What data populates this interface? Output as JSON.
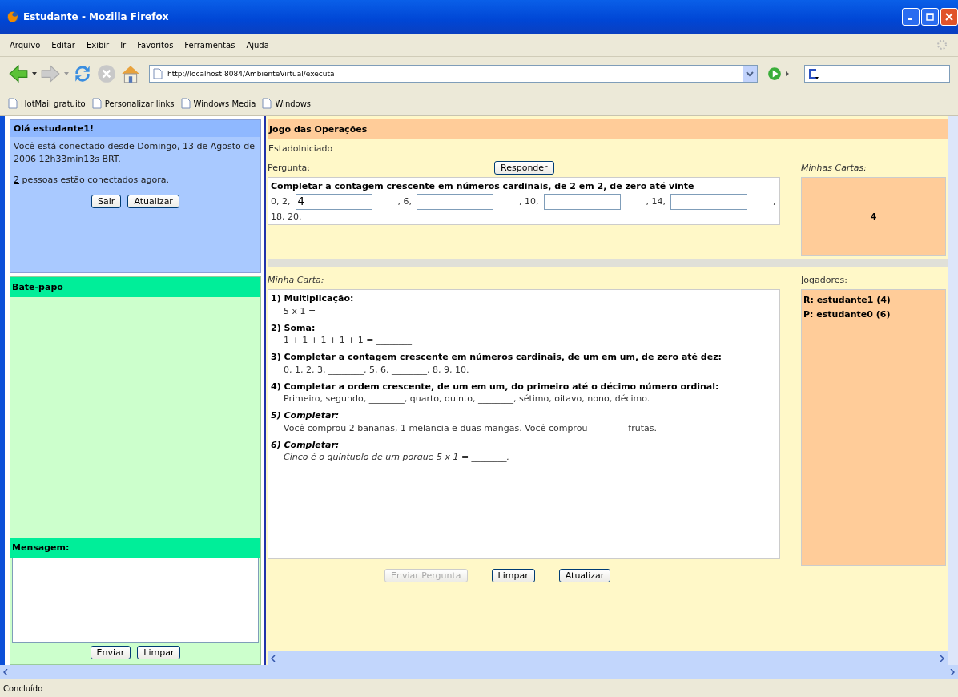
{
  "window": {
    "title": "Estudante - Mozilla Firefox"
  },
  "menu": [
    "Arquivo",
    "Editar",
    "Exibir",
    "Ir",
    "Favoritos",
    "Ferramentas",
    "Ajuda"
  ],
  "address": {
    "value": "http://localhost:8084/AmbienteVirtual/executa"
  },
  "bookmarks": [
    "HotMail gratuito",
    "Personalizar links",
    "Windows Media",
    "Windows"
  ],
  "session": {
    "greeting": "Olá estudante1!",
    "connected_text": "Você está conectado desde Domingo, 13 de Agosto de 2006 12h33min13s BRT.",
    "people_count": "2",
    "people_text": "pessoas estão conectados agora.",
    "buttons": [
      "Sair",
      "Atualizar"
    ]
  },
  "chat": {
    "title": "Bate-papo",
    "message_label": "Mensagem:",
    "buttons": [
      "Enviar",
      "Limpar"
    ]
  },
  "game": {
    "title": "Jogo das Operações",
    "status": "EstadoIniciado",
    "question_label": "Pergunta:",
    "answer_button": "Responder",
    "question": "Completar a contagem crescente em números cardinais, de 2 em 2, de zero até vinte",
    "sequence": [
      {
        "kind": "text",
        "text": "0, 2,"
      },
      {
        "kind": "field",
        "value": "4"
      },
      {
        "kind": "text",
        "text": ", 6,"
      },
      {
        "kind": "field"
      },
      {
        "kind": "text",
        "text": ", 10,"
      },
      {
        "kind": "field"
      },
      {
        "kind": "text",
        "text": ", 14,"
      },
      {
        "kind": "field"
      },
      {
        "kind": "text",
        "text": ","
      },
      {
        "kind": "text",
        "text": "18, 20."
      }
    ],
    "my_cards_label": "Minhas Cartas:",
    "my_cards": [
      "4"
    ],
    "my_card_label": "Minha Carta:",
    "card_items": [
      {
        "heading": "1) Multiplicação:",
        "italic": false,
        "body": "5 x 1 = ________",
        "body_italic": false
      },
      {
        "heading": "2) Soma:",
        "italic": false,
        "body": "1 + 1 + 1 + 1 + 1 = ________",
        "body_italic": false
      },
      {
        "heading": "3) Completar a contagem crescente em números cardinais, de um em um, de zero até dez:",
        "italic": false,
        "body": "0, 1, 2, 3, ________, 5, 6, ________, 8, 9, 10.",
        "body_italic": false
      },
      {
        "heading": "4) Completar a ordem crescente, de um em um, do primeiro até o décimo número ordinal:",
        "italic": false,
        "body": "Primeiro, segundo, ________, quarto, quinto, ________, sétimo, oitavo, nono, décimo.",
        "body_italic": false
      },
      {
        "heading": "5) Completar:",
        "italic": true,
        "body": "Você comprou 2 bananas, 1 melancia e duas mangas. Você comprou ________ frutas.",
        "body_italic": false
      },
      {
        "heading": "6) Completar:",
        "italic": true,
        "body": "Cinco é o quíntuplo de um porque 5 x 1 = ________.",
        "body_italic": true
      }
    ],
    "players_label": "Jogadores:",
    "players": [
      "R: estudante1 (4)",
      "P: estudante0 (6)"
    ],
    "buttons": [
      {
        "label": "Enviar Pergunta",
        "disabled": true
      },
      {
        "label": "Limpar",
        "disabled": false
      },
      {
        "label": "Atualizar",
        "disabled": false
      }
    ]
  },
  "status_bar": "Concluído"
}
